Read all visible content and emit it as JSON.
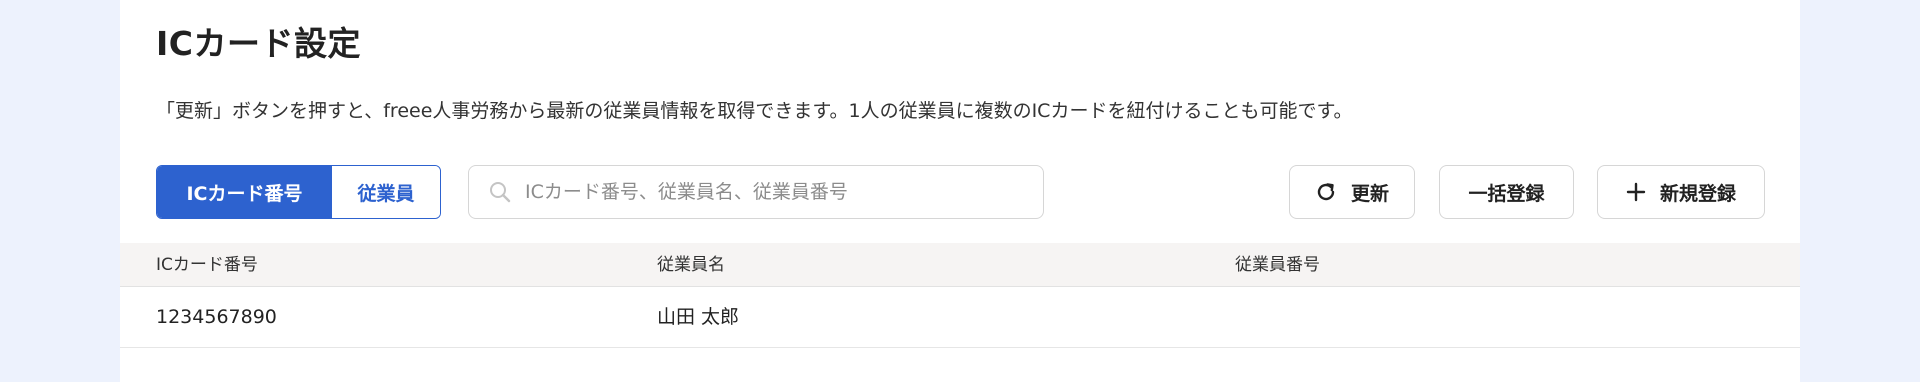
{
  "page": {
    "title": "ICカード設定",
    "description": "「更新」ボタンを押すと、freee人事労務から最新の従業員情報を取得できます。1人の従業員に複数のICカードを紐付けることも可能です。"
  },
  "view_toggle": {
    "options": [
      {
        "label": "ICカード番号",
        "selected": true
      },
      {
        "label": "従業員",
        "selected": false
      }
    ]
  },
  "search": {
    "placeholder": "ICカード番号、従業員名、従業員番号",
    "value": "",
    "icon": "search-icon"
  },
  "actions": {
    "refresh": {
      "label": "更新",
      "icon": "refresh-icon"
    },
    "bulk_register": {
      "label": "一括登録"
    },
    "new_register": {
      "label": "新規登録",
      "icon": "plus-icon"
    }
  },
  "table": {
    "columns": [
      "ICカード番号",
      "従業員名",
      "従業員番号"
    ],
    "rows": [
      {
        "card_number": "1234567890",
        "employee_name": "山田 太郎",
        "employee_number": ""
      }
    ]
  },
  "colors": {
    "accent": "#2d62cf",
    "page_background": "#edf2fd",
    "header_background": "#f6f4f3"
  }
}
